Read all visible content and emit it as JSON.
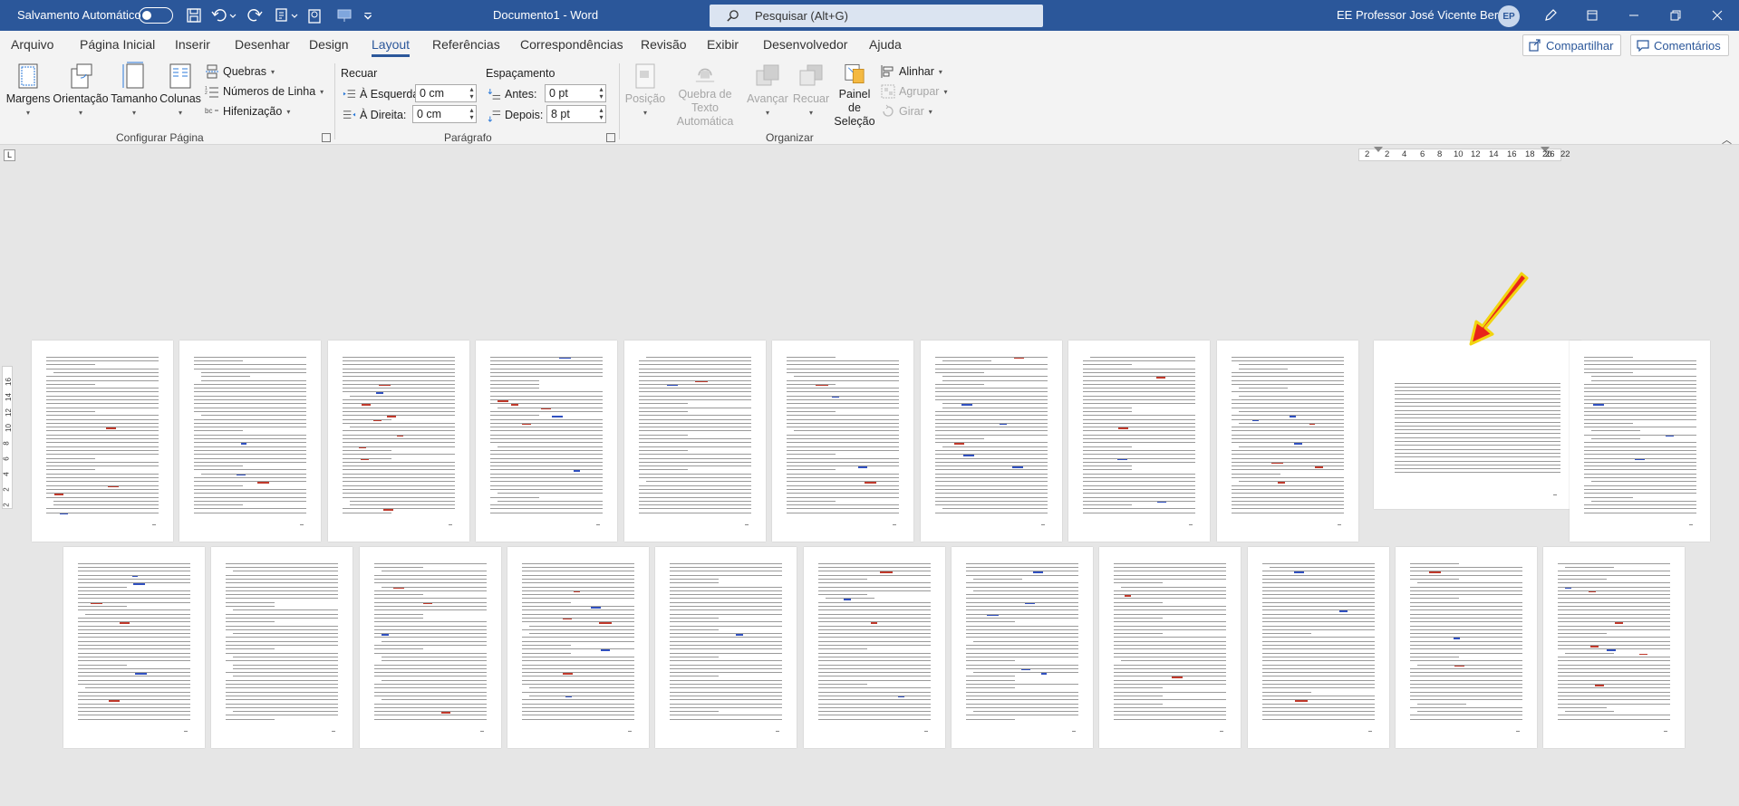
{
  "titlebar": {
    "autosave_label": "Salvamento Automático",
    "doc_title": "Documento1  -  Word",
    "search_placeholder": "Pesquisar (Alt+G)",
    "user_name": "EE Professor José Vicente Bertoli",
    "user_initials": "EP"
  },
  "tabs": [
    "Arquivo",
    "Página Inicial",
    "Inserir",
    "Desenhar",
    "Design",
    "Layout",
    "Referências",
    "Correspondências",
    "Revisão",
    "Exibir",
    "Desenvolvedor",
    "Ajuda"
  ],
  "active_tab": "Layout",
  "share": {
    "share_label": "Compartilhar",
    "comments_label": "Comentários"
  },
  "ribbon": {
    "page_setup": {
      "margens": "Margens",
      "orientacao": "Orientação",
      "tamanho": "Tamanho",
      "colunas": "Colunas",
      "quebras": "Quebras",
      "numeros_linha": "Números de Linha",
      "hifenizacao": "Hifenização",
      "group_label": "Configurar Página"
    },
    "paragraph": {
      "recuar_label": "Recuar",
      "espacamento_label": "Espaçamento",
      "esquerda_label": "À Esquerda:",
      "esquerda_value": "0 cm",
      "direita_label": "À Direita:",
      "direita_value": "0 cm",
      "antes_label": "Antes:",
      "antes_value": "0 pt",
      "depois_label": "Depois:",
      "depois_value": "8 pt",
      "group_label": "Parágrafo"
    },
    "arrange": {
      "posicao": "Posição",
      "quebra_texto_1": "Quebra de Texto",
      "quebra_texto_2": "Automática",
      "avancar": "Avançar",
      "recuar": "Recuar",
      "painel_1": "Painel de",
      "painel_2": "Seleção",
      "alinhar": "Alinhar",
      "agrupar": "Agrupar",
      "girar": "Girar",
      "group_label": "Organizar"
    }
  },
  "ruler": {
    "h_ticks": [
      "2",
      "2",
      "4",
      "6",
      "8",
      "10",
      "12",
      "14",
      "16",
      "18",
      "20",
      "22",
      "26"
    ],
    "v_ticks": [
      "2",
      "2",
      "4",
      "6",
      "8",
      "10",
      "12",
      "14",
      "16"
    ]
  },
  "document": {
    "rows": 2,
    "pages_row1": 11,
    "pages_row2": 11
  }
}
